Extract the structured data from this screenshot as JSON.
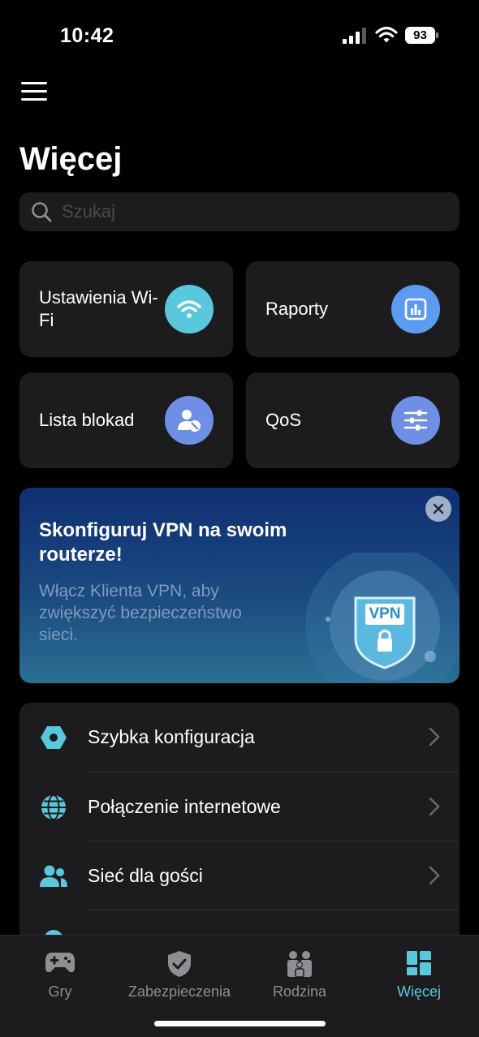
{
  "status_bar": {
    "time": "10:42",
    "battery": "93"
  },
  "page": {
    "title": "Więcej"
  },
  "search": {
    "placeholder": "Szukaj"
  },
  "tiles": [
    {
      "label": "Ustawienia Wi-Fi",
      "icon": "wifi-icon",
      "color": "#5ac8dc"
    },
    {
      "label": "Raporty",
      "icon": "bar-chart-icon",
      "color": "#5b9cf0"
    },
    {
      "label": "Lista blokad",
      "icon": "block-user-icon",
      "color": "#6f8fe6"
    },
    {
      "label": "QoS",
      "icon": "sliders-icon",
      "color": "#6f8fe6"
    }
  ],
  "promo": {
    "title": "Skonfiguruj VPN na swoim routerze!",
    "text": "Włącz Klienta VPN, aby zwiększyć bezpieczeństwo sieci.",
    "badge": "VPN"
  },
  "list": [
    {
      "label": "Szybka konfiguracja",
      "icon": "hexagon-icon"
    },
    {
      "label": "Połączenie internetowe",
      "icon": "globe-icon"
    },
    {
      "label": "Sieć dla gości",
      "icon": "guests-icon"
    }
  ],
  "tabs": [
    {
      "label": "Gry",
      "icon": "gamepad-icon"
    },
    {
      "label": "Zabezpieczenia",
      "icon": "shield-icon"
    },
    {
      "label": "Rodzina",
      "icon": "family-icon"
    },
    {
      "label": "Więcej",
      "icon": "grid-icon",
      "active": true
    }
  ],
  "colors": {
    "accent": "#5ac8dc",
    "background": "#000000",
    "card": "#1c1c1e"
  }
}
